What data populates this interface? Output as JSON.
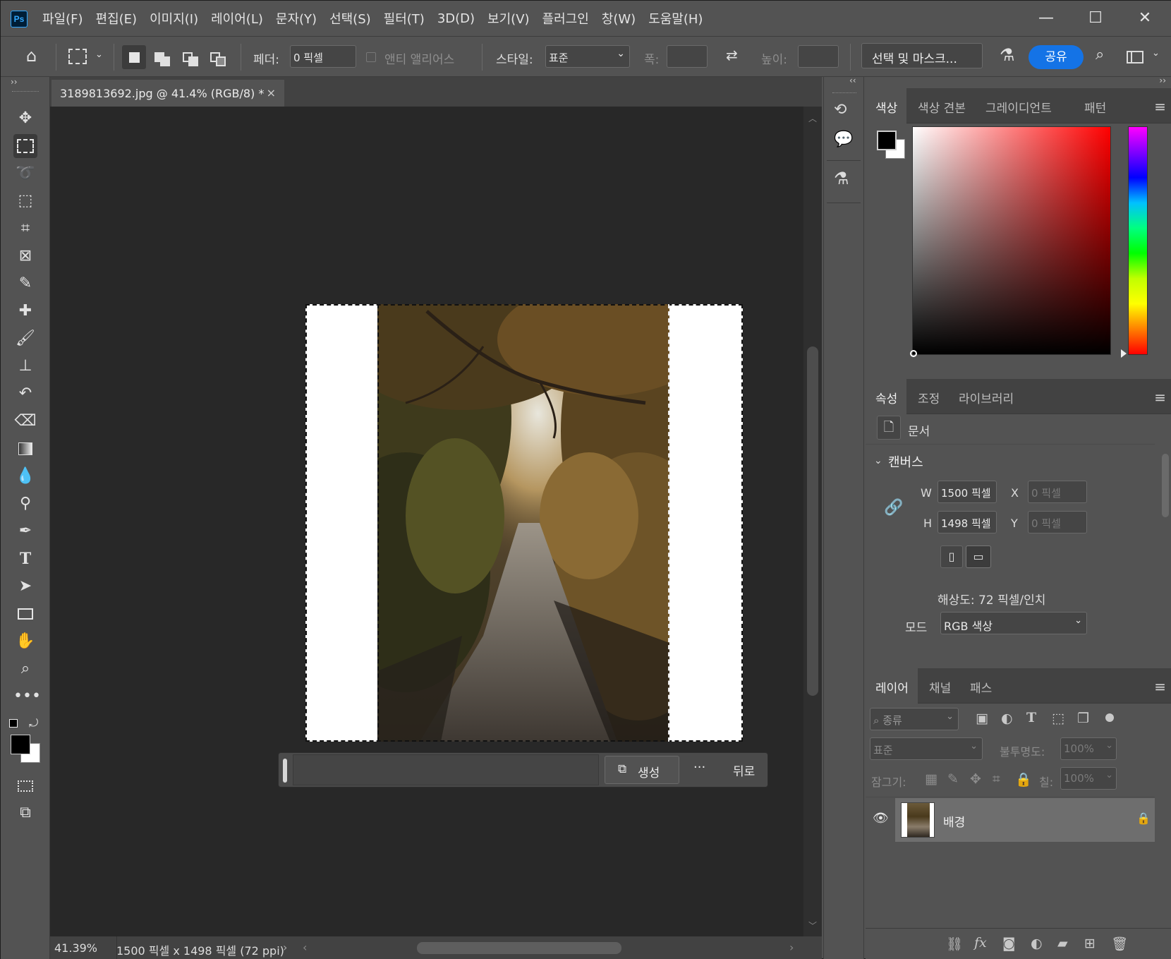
{
  "app": {
    "logo": "Ps"
  },
  "menu": [
    "파일(F)",
    "편집(E)",
    "이미지(I)",
    "레이어(L)",
    "문자(Y)",
    "선택(S)",
    "필터(T)",
    "3D(D)",
    "보기(V)",
    "플러그인",
    "창(W)",
    "도움말(H)"
  ],
  "options": {
    "feather_label": "페더:",
    "feather_value": "0 픽셀",
    "antialias_label": "앤티 앨리어스",
    "style_label": "스타일:",
    "style_value": "표준",
    "width_label": "폭:",
    "height_label": "높이:",
    "select_mask_label": "선택 및 마스크...",
    "share_label": "공유"
  },
  "document": {
    "tab_title": "3189813692.jpg @ 41.4% (RGB/8) *",
    "close_glyph": "×"
  },
  "status": {
    "zoom": "41.39%",
    "size_info": "1500 픽셀 x 1498 픽셀 (72 ppi)"
  },
  "context_bar": {
    "generate_label": "생성",
    "more_label": "···",
    "back_label": "뒤로"
  },
  "color_panel": {
    "tabs": [
      "색상",
      "색상 견본",
      "그레이디언트",
      "패턴"
    ],
    "hue_color": "#ff0000",
    "foreground": "#000000",
    "background": "#ffffff"
  },
  "properties_panel": {
    "tabs": [
      "속성",
      "조정",
      "라이브러리"
    ],
    "doc_label": "문서",
    "canvas_section": "캔버스",
    "w_label": "W",
    "w_value": "1500 픽셀",
    "h_label": "H",
    "h_value": "1498 픽셀",
    "x_label": "X",
    "x_value": "0 픽셀",
    "y_label": "Y",
    "y_value": "0 픽셀",
    "resolution": "해상도: 72 픽셀/인치",
    "mode_label": "모드",
    "mode_value": "RGB 색상"
  },
  "layers_panel": {
    "tabs": [
      "레이어",
      "채널",
      "패스"
    ],
    "filter_label": "종류",
    "blend_mode": "표준",
    "opacity_label": "불투명도:",
    "opacity_value": "100%",
    "lock_label": "잠그기:",
    "fill_label": "칠:",
    "fill_value": "100%",
    "layers": [
      {
        "name": "배경"
      }
    ]
  }
}
